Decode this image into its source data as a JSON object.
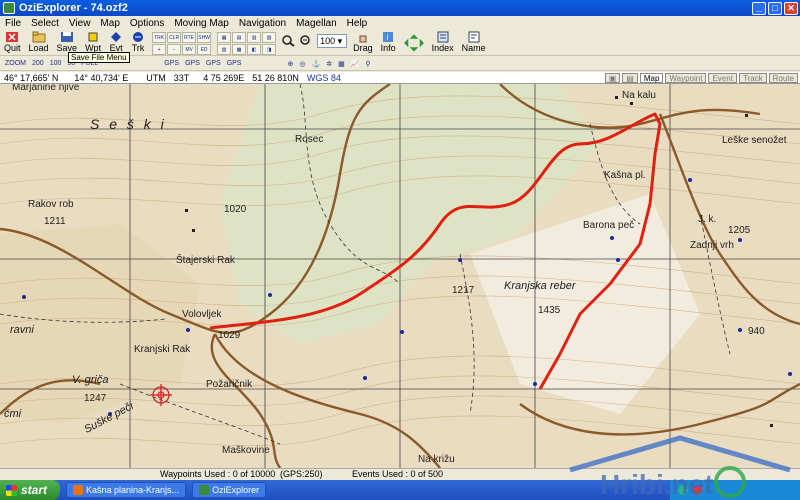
{
  "window": {
    "title": "OziExplorer - 74.ozf2",
    "controls": {
      "minimize": "_",
      "maximize": "□",
      "close": "✕"
    }
  },
  "menu": [
    "File",
    "Select",
    "View",
    "Map",
    "Options",
    "Moving Map",
    "Navigation",
    "Magellan",
    "Help"
  ],
  "toolbar": {
    "buttons": [
      {
        "name": "quit",
        "label": "Quit",
        "icon": "quit-icon"
      },
      {
        "name": "load",
        "label": "Load",
        "icon": "load-icon"
      },
      {
        "name": "save",
        "label": "Save",
        "icon": "save-icon"
      },
      {
        "name": "wpt",
        "label": "Wpt",
        "icon": "waypoint-icon"
      },
      {
        "name": "evt",
        "label": "Evt",
        "icon": "event-icon"
      },
      {
        "name": "trk",
        "label": "Trk",
        "icon": "track-icon"
      }
    ],
    "zoom_value": "100",
    "right_buttons": [
      {
        "name": "drag",
        "label": "Drag",
        "icon": "drag-hand-icon"
      },
      {
        "name": "info",
        "label": "Info",
        "icon": "info-icon"
      },
      {
        "name": "index",
        "label": "Index",
        "icon": "index-icon"
      },
      {
        "name": "name",
        "label": "Name",
        "icon": "name-icon"
      }
    ],
    "tooltip": "Save File Menu",
    "zoom_presets": [
      "ZOOM",
      "200",
      "100",
      "50",
      "FULL"
    ],
    "gps_buttons": [
      "GPS",
      "GPS",
      "GPS",
      "GPS"
    ]
  },
  "coords": {
    "lat": "46° 17,665' N",
    "lon": "14° 40,734' E",
    "utm": "UTM",
    "zone": "33T",
    "easting": "4 75 269E",
    "northing": "51 26 810N",
    "datum": "WGS 84"
  },
  "tabs": [
    "Map",
    "Waypoint",
    "Event",
    "Track",
    "Route"
  ],
  "map": {
    "labels": {
      "marjanine": "Marjanine njive",
      "seski": "S e š k i",
      "rakov_rob": "Rakov rob",
      "h1211": "1211",
      "h1020": "1020",
      "rosec": "Rosec",
      "stajerski": "Štajerski Rak",
      "h1217": "1217",
      "volovljek": "Volovljek",
      "h1029": "1029",
      "kranjski_rak": "Kranjski Rak",
      "pozarcnik": "Požaričnik",
      "v_grica": "V. griča",
      "h1247": "1247",
      "suske_peci": "Suške peči",
      "ravni": "ravni",
      "cmi": "čmi",
      "maskovine": "Maškovine",
      "na_krizu": "Na križu",
      "na_kalu": "Na kalu",
      "kasna_pl": "Kašna pl.",
      "barona_pec": "Barona peč",
      "kranjska_reber": "Kranjska reber",
      "h1435": "1435",
      "leske": "Leške senožet",
      "h1205": "1205",
      "zadnji_vrh": "Zadnji vrh",
      "h940": "940",
      "jk": "J. k."
    }
  },
  "status": {
    "waypoints": "Waypoints Used : 0 of 10000",
    "gps": "(GPS:250)",
    "events": "Events Used : 0 of 500"
  },
  "taskbar": {
    "start": "start",
    "items": [
      "Kašna planina-Kranjs...",
      "OziExplorer"
    ]
  },
  "watermark": "Hribi.net"
}
